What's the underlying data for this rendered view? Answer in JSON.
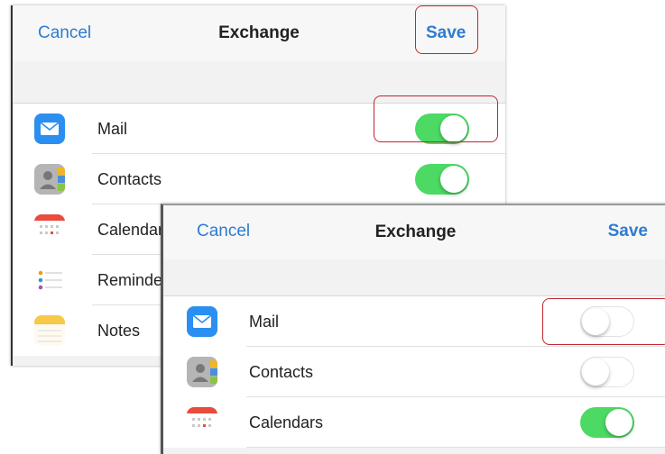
{
  "back_panel": {
    "title": "Exchange",
    "cancel_label": "Cancel",
    "save_label": "Save",
    "items": [
      {
        "label": "Mail",
        "icon": "mail-icon",
        "enabled": true
      },
      {
        "label": "Contacts",
        "icon": "contacts-icon",
        "enabled": true
      },
      {
        "label": "Calendars",
        "icon": "calendar-icon"
      },
      {
        "label": "Reminders",
        "icon": "reminders-icon"
      },
      {
        "label": "Notes",
        "icon": "notes-icon"
      }
    ]
  },
  "front_panel": {
    "title": "Exchange",
    "cancel_label": "Cancel",
    "save_label": "Save",
    "items": [
      {
        "label": "Mail",
        "icon": "mail-icon",
        "enabled": false
      },
      {
        "label": "Contacts",
        "icon": "contacts-icon",
        "enabled": false
      },
      {
        "label": "Calendars",
        "icon": "calendar-icon",
        "enabled": true
      }
    ]
  },
  "colors": {
    "accent": "#2f7bd1",
    "toggle_on": "#4cd964",
    "highlight": "#c0262d"
  }
}
